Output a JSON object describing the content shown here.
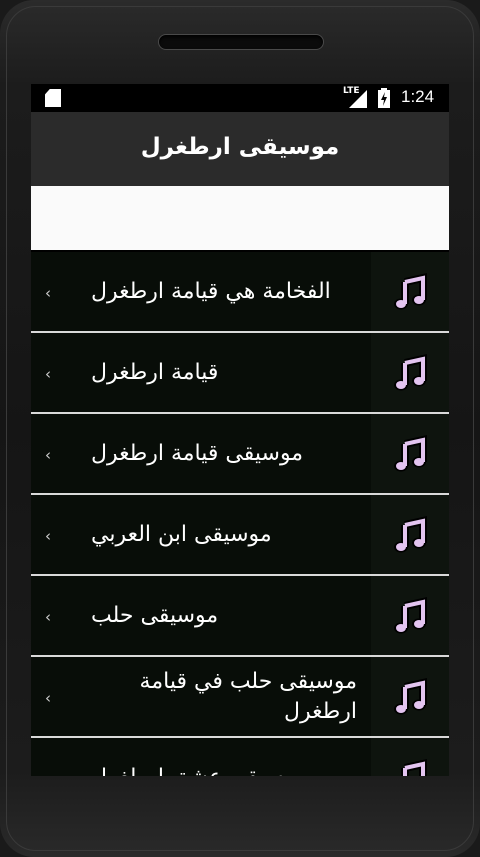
{
  "status_bar": {
    "network_label": "LTE",
    "time": "1:24"
  },
  "app_bar": {
    "title": "موسيقى ارطغرل"
  },
  "list": {
    "items": [
      {
        "label": "الفخامة هي قيامة ارطغرل",
        "icon": "music-note-icon"
      },
      {
        "label": "قيامة ارطغرل",
        "icon": "music-note-icon"
      },
      {
        "label": "موسيقى قيامة ارطغرل",
        "icon": "music-note-icon"
      },
      {
        "label": "موسيقى ابن العربي",
        "icon": "music-note-icon"
      },
      {
        "label": "موسيقى حلب",
        "icon": "music-note-icon"
      },
      {
        "label": "موسيقى حلب في قيامة ارطغرل",
        "icon": "music-note-icon"
      },
      {
        "label": "موسيقى عشق ارطغرل",
        "icon": "music-note-icon"
      }
    ]
  },
  "colors": {
    "app_bar": "#2b2b2b",
    "list_bg": "#080d08",
    "note_fill": "#e3c4f0",
    "divider": "#d9d9d9"
  }
}
